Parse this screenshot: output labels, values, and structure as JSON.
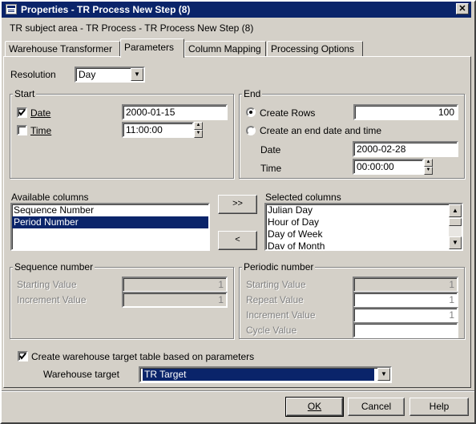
{
  "window": {
    "title": "Properties - TR Process New Step (8)",
    "close_symbol": "✕"
  },
  "subtitle": "TR subject area - TR Process - TR Process New Step (8)",
  "tabs": [
    {
      "label": "Warehouse Transformer",
      "active": false
    },
    {
      "label": "Parameters",
      "active": true
    },
    {
      "label": "Column Mapping",
      "active": false
    },
    {
      "label": "Processing Options",
      "active": false
    }
  ],
  "resolution": {
    "label": "Resolution",
    "value": "Day"
  },
  "start": {
    "title": "Start",
    "date": {
      "label": "Date",
      "checked": true,
      "value": "2000-01-15"
    },
    "time": {
      "label": "Time",
      "checked": false,
      "value": "11:00:00"
    }
  },
  "end": {
    "title": "End",
    "create_rows": {
      "label": "Create Rows",
      "selected": true,
      "value": "100"
    },
    "create_end": {
      "label": "Create an end date and time",
      "selected": false
    },
    "date": {
      "label": "Date",
      "value": "2000-02-28"
    },
    "time": {
      "label": "Time",
      "value": "00:00:00"
    }
  },
  "available_columns": {
    "label": "Available columns",
    "items": [
      "Sequence Number",
      "Period Number"
    ],
    "selected_index": 1
  },
  "move_buttons": {
    "add": ">>",
    "remove": "<"
  },
  "selected_columns": {
    "label": "Selected columns",
    "items": [
      "Julian Day",
      "Hour of Day",
      "Day of Week",
      "Day of Month"
    ]
  },
  "sequence_number": {
    "title": "Sequence number",
    "starting_value": {
      "label": "Starting Value",
      "value": "1"
    },
    "increment_value": {
      "label": "Increment Value",
      "value": "1"
    }
  },
  "periodic_number": {
    "title": "Periodic number",
    "starting_value": {
      "label": "Starting Value",
      "value": "1"
    },
    "repeat_value": {
      "label": "Repeat Value",
      "value": "1"
    },
    "increment_value": {
      "label": "Increment Value",
      "value": "1"
    },
    "cycle_value": {
      "label": "Cycle Value",
      "value": ""
    }
  },
  "create_target": {
    "label": "Create warehouse target table based on parameters",
    "checked": true
  },
  "warehouse_target": {
    "label": "Warehouse target",
    "value": "TR Target"
  },
  "buttons": {
    "ok": "OK",
    "cancel": "Cancel",
    "help": "Help"
  },
  "icons": {
    "dropdown": "chevron-down-icon",
    "spin_up": "arrow-up-icon",
    "spin_down": "arrow-down-icon",
    "check": "checkmark-icon"
  },
  "colors": {
    "title_bar": "#0a246a",
    "face": "#d4d0c8",
    "selection": "#0a246a"
  }
}
